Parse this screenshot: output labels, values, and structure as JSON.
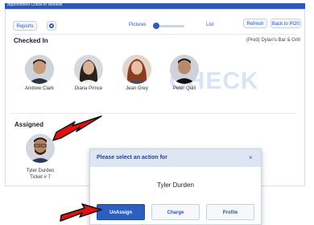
{
  "window": {
    "title": "Appointment Check-in Window"
  },
  "toolbar": {
    "reports_label": "Reports",
    "pictures_label": "Pictures",
    "list_label": "List",
    "refresh_label": "Refresh",
    "back_label": "Back to POS"
  },
  "checked_in": {
    "heading": "Checked In",
    "filter_text": "(Prod) Dylan's Bar & Grill",
    "people": [
      {
        "name": "Andrew Clark"
      },
      {
        "name": "Diana Prince"
      },
      {
        "name": "Jean Grey"
      },
      {
        "name": "Peter Quill"
      }
    ]
  },
  "watermark": "CHECK",
  "assigned": {
    "heading": "Assigned",
    "person_name": "Tyler Durden",
    "ticket": "Ticket # 7"
  },
  "modal": {
    "title": "Please select an action for",
    "close": "×",
    "person": "Tyler Durden",
    "unassign_label": "UnAssign",
    "charge_label": "Charge",
    "profile_label": "Profile"
  },
  "colors": {
    "accent": "#2d5fc1",
    "arrow": "#e0120f"
  }
}
